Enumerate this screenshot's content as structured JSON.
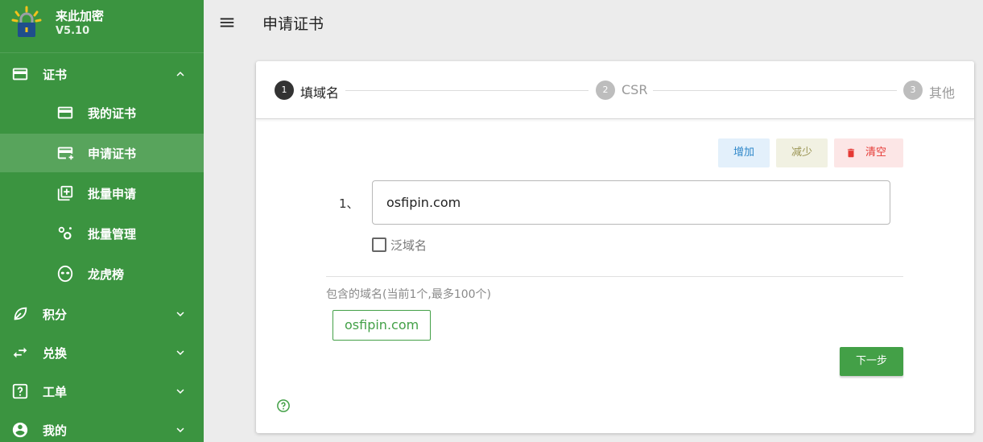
{
  "brand": {
    "name": "来此加密",
    "version": "V5.10"
  },
  "nav": {
    "cert": "证书",
    "my_cert": "我的证书",
    "apply_cert": "申请证书",
    "batch_apply": "批量申请",
    "batch_manage": "批量管理",
    "leaderboard": "龙虎榜",
    "points": "积分",
    "exchange": "兑换",
    "ticket": "工单",
    "mine": "我的"
  },
  "header": {
    "title": "申请证书"
  },
  "stepper": {
    "steps": [
      {
        "num": "1",
        "label": "填域名",
        "active": true
      },
      {
        "num": "2",
        "label": "CSR",
        "active": false
      },
      {
        "num": "3",
        "label": "其他",
        "active": false
      }
    ]
  },
  "actions": {
    "add": "增加",
    "reduce": "减少",
    "clear": "清空"
  },
  "form": {
    "row_index": "1、",
    "domain_value": "osfipin.com",
    "wildcard_label": "泛域名",
    "included_label": "包含的域名(当前1个,最多100个)",
    "chip": "osfipin.com",
    "next": "下一步"
  },
  "colors": {
    "sidebar": "#3b9440",
    "accent": "#43a047",
    "active_step": "#333333",
    "inactive_step": "#bdbdbd"
  },
  "icons": [
    "logo-lock-icon",
    "credit-card-icon",
    "chevron-up-icon",
    "chevron-down-icon",
    "card-add-icon",
    "library-add-icon",
    "cogs-icon",
    "alien-icon",
    "leaf-icon",
    "swap-icon",
    "help-box-icon",
    "account-circle-icon",
    "menu-icon",
    "trash-icon",
    "help-circle-icon"
  ]
}
